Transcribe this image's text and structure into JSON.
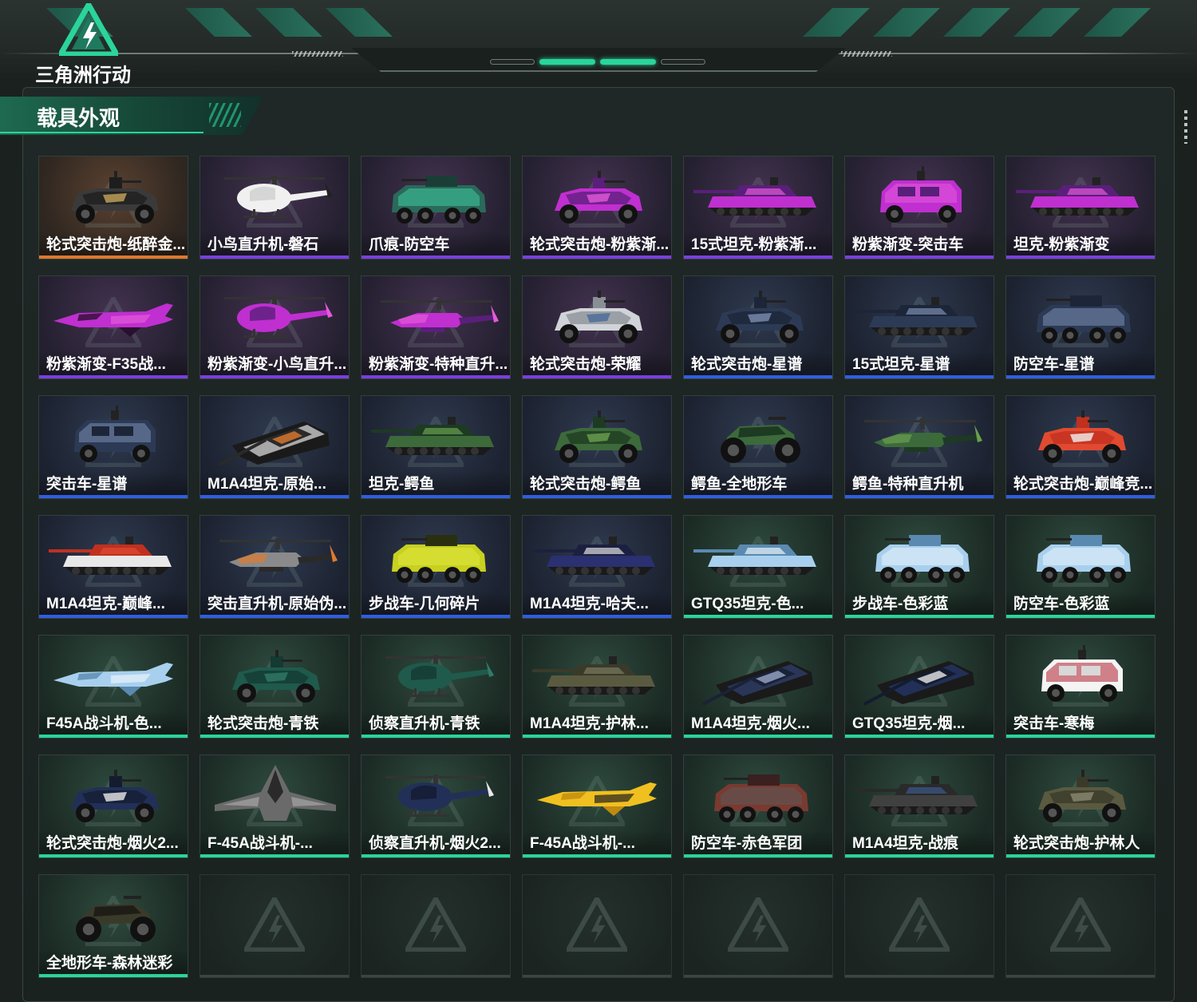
{
  "header": {
    "logo_text": "三角洲行动"
  },
  "section": {
    "title": "载具外观"
  },
  "colors": {
    "accent": "#2ad49b",
    "orange": "#e0782e",
    "purple": "#7a3fe0",
    "blue": "#2f5fe0",
    "green": "#2ad49b"
  },
  "items": [
    {
      "label": "轮式突击炮-纸醉金...",
      "rarity": "orange",
      "kind": "armored-car",
      "colors": [
        "#1d1d1d",
        "#3a3a3a",
        "#c7a55a"
      ]
    },
    {
      "label": "小鸟直升机-磐石",
      "rarity": "purple",
      "kind": "helicopter",
      "colors": [
        "#cfcfcf",
        "#f0f0f0",
        "#222222"
      ]
    },
    {
      "label": "爪痕-防空车",
      "rarity": "purple",
      "kind": "apc",
      "colors": [
        "#1a3e36",
        "#2a6a5a",
        "#40c9a0"
      ]
    },
    {
      "label": "轮式突击炮-粉紫渐...",
      "rarity": "purple",
      "kind": "armored-car",
      "colors": [
        "#5a1f7a",
        "#c02fd0",
        "#e45ad8"
      ]
    },
    {
      "label": "15式坦克-粉紫渐...",
      "rarity": "purple",
      "kind": "tank",
      "colors": [
        "#5a1f7a",
        "#c02fd0",
        "#e45ad8"
      ]
    },
    {
      "label": "粉紫渐变-突击车",
      "rarity": "purple",
      "kind": "truck",
      "colors": [
        "#5a1f7a",
        "#c02fd0",
        "#e45ad8"
      ]
    },
    {
      "label": "坦克-粉紫渐变",
      "rarity": "purple",
      "kind": "tank",
      "colors": [
        "#5a1f7a",
        "#c02fd0",
        "#e45ad8"
      ]
    },
    {
      "label": "粉紫渐变-F35战...",
      "rarity": "purple",
      "kind": "jet",
      "colors": [
        "#2a1030",
        "#c02fd0",
        "#e45ad8"
      ]
    },
    {
      "label": "粉紫渐变-小鸟直升...",
      "rarity": "purple",
      "kind": "helicopter",
      "colors": [
        "#5a1f7a",
        "#c02fd0",
        "#e45ad8"
      ]
    },
    {
      "label": "粉紫渐变-特种直升...",
      "rarity": "purple",
      "kind": "attack-heli",
      "colors": [
        "#5a1f7a",
        "#c02fd0",
        "#e45ad8"
      ]
    },
    {
      "label": "轮式突击炮-荣耀",
      "rarity": "purple",
      "kind": "armored-car",
      "colors": [
        "#8a8f95",
        "#d0d4d8",
        "#4a6a9a"
      ]
    },
    {
      "label": "轮式突击炮-星谱",
      "rarity": "blue",
      "kind": "armored-car",
      "colors": [
        "#1c2638",
        "#2c3a55",
        "#7a8db0"
      ]
    },
    {
      "label": "15式坦克-星谱",
      "rarity": "blue",
      "kind": "tank",
      "colors": [
        "#1c2638",
        "#2c3a55",
        "#7a8db0"
      ]
    },
    {
      "label": "防空车-星谱",
      "rarity": "blue",
      "kind": "apc",
      "colors": [
        "#1c2638",
        "#2c3a55",
        "#7a8db0"
      ]
    },
    {
      "label": "突击车-星谱",
      "rarity": "blue",
      "kind": "truck",
      "colors": [
        "#1c2638",
        "#2c3a55",
        "#7a8db0"
      ]
    },
    {
      "label": "M1A4坦克-原始...",
      "rarity": "blue",
      "kind": "tank-angled",
      "colors": [
        "#2a2a2a",
        "#a8a8a8",
        "#e07a2e"
      ]
    },
    {
      "label": "坦克-鳄鱼",
      "rarity": "blue",
      "kind": "tank",
      "colors": [
        "#1d3a22",
        "#3c6a3a",
        "#6aa050"
      ]
    },
    {
      "label": "轮式突击炮-鳄鱼",
      "rarity": "blue",
      "kind": "armored-car",
      "colors": [
        "#1d3a22",
        "#3c6a3a",
        "#6aa050"
      ]
    },
    {
      "label": "鳄鱼-全地形车",
      "rarity": "blue",
      "kind": "atv",
      "colors": [
        "#1d3a22",
        "#3c6a3a",
        "#6aa050"
      ]
    },
    {
      "label": "鳄鱼-特种直升机",
      "rarity": "blue",
      "kind": "attack-heli",
      "colors": [
        "#1d3a22",
        "#3c6a3a",
        "#6aa050"
      ]
    },
    {
      "label": "轮式突击炮-巅峰竞...",
      "rarity": "blue",
      "kind": "armored-car",
      "colors": [
        "#c0301f",
        "#e04a30",
        "#f0f0f0"
      ]
    },
    {
      "label": "M1A4坦克-巅峰...",
      "rarity": "blue",
      "kind": "tank",
      "colors": [
        "#c0301f",
        "#e8e8e8",
        "#e04a30"
      ]
    },
    {
      "label": "突击直升机-原始伪...",
      "rarity": "blue",
      "kind": "attack-heli",
      "colors": [
        "#2a2a2a",
        "#8a8a8a",
        "#e07a2e"
      ]
    },
    {
      "label": "步战车-几何碎片",
      "rarity": "blue",
      "kind": "apc",
      "colors": [
        "#2a2f10",
        "#c8d020",
        "#e0e840"
      ]
    },
    {
      "label": "M1A4坦克-哈夫...",
      "rarity": "blue",
      "kind": "tank",
      "colors": [
        "#1c2040",
        "#2a3070",
        "#e0e0e0"
      ]
    },
    {
      "label": "GTQ35坦克-色...",
      "rarity": "green",
      "kind": "tank",
      "colors": [
        "#5a8ab0",
        "#a8d0ee",
        "#e8f2fa"
      ]
    },
    {
      "label": "步战车-色彩蓝",
      "rarity": "green",
      "kind": "apc",
      "colors": [
        "#5a8ab0",
        "#a8d0ee",
        "#e8f2fa"
      ]
    },
    {
      "label": "防空车-色彩蓝",
      "rarity": "green",
      "kind": "apc",
      "colors": [
        "#5a8ab0",
        "#a8d0ee",
        "#e8f2fa"
      ]
    },
    {
      "label": "F45A战斗机-色...",
      "rarity": "green",
      "kind": "jet",
      "colors": [
        "#5a8ab0",
        "#a8d0ee",
        "#e8f2fa"
      ]
    },
    {
      "label": "轮式突击炮-青铁",
      "rarity": "green",
      "kind": "armored-car",
      "colors": [
        "#143a32",
        "#1f5a4c",
        "#2f7a66"
      ]
    },
    {
      "label": "侦察直升机-青铁",
      "rarity": "green",
      "kind": "helicopter",
      "colors": [
        "#143a32",
        "#1f5a4c",
        "#2f7a66"
      ]
    },
    {
      "label": "M1A4坦克-护林...",
      "rarity": "green",
      "kind": "tank",
      "colors": [
        "#3a3a2a",
        "#5a5a40",
        "#7a7a60"
      ]
    },
    {
      "label": "M1A4坦克-烟火...",
      "rarity": "green",
      "kind": "tank-angled",
      "colors": [
        "#1a2238",
        "#2a3658",
        "#9aa8c8"
      ]
    },
    {
      "label": "GTQ35坦克-烟...",
      "rarity": "green",
      "kind": "tank-angled",
      "colors": [
        "#141c30",
        "#223058",
        "#e8e8e8"
      ]
    },
    {
      "label": "突击车-寒梅",
      "rarity": "green",
      "kind": "truck",
      "colors": [
        "#d8d8d8",
        "#f4f4f4",
        "#b02030"
      ]
    },
    {
      "label": "轮式突击炮-烟火2...",
      "rarity": "green",
      "kind": "armored-car",
      "colors": [
        "#141c30",
        "#223058",
        "#e8e8e8"
      ]
    },
    {
      "label": "F-45A战斗机-...",
      "rarity": "green",
      "kind": "jet-front",
      "colors": [
        "#2a2a2a",
        "#6a6a6a",
        "#b0b0b0"
      ]
    },
    {
      "label": "侦察直升机-烟火2...",
      "rarity": "green",
      "kind": "helicopter",
      "colors": [
        "#141c30",
        "#223058",
        "#e8e8e8"
      ]
    },
    {
      "label": "F-45A战斗机-...",
      "rarity": "green",
      "kind": "jet",
      "colors": [
        "#c08a10",
        "#f0c020",
        "#202020"
      ]
    },
    {
      "label": "防空车-赤色军团",
      "rarity": "green",
      "kind": "apc",
      "colors": [
        "#3a2020",
        "#7a3a30",
        "#5a5a5a"
      ]
    },
    {
      "label": "M1A4坦克-战痕",
      "rarity": "green",
      "kind": "tank",
      "colors": [
        "#2a2a2a",
        "#404040",
        "#3a5a8a"
      ]
    },
    {
      "label": "轮式突击炮-护林人",
      "rarity": "green",
      "kind": "armored-car",
      "colors": [
        "#3a3a2a",
        "#5a5a40",
        "#8a8a70"
      ]
    },
    {
      "label": "全地形车-森林迷彩",
      "rarity": "green",
      "kind": "atv",
      "colors": [
        "#1e1e16",
        "#3a3a2a",
        "#5a5a40"
      ]
    }
  ],
  "empty_slots": 6
}
